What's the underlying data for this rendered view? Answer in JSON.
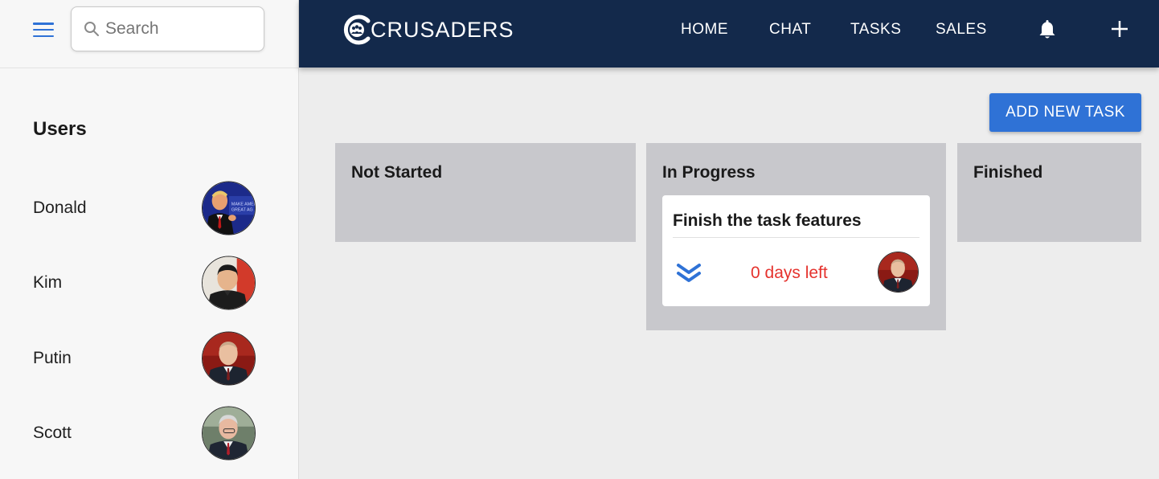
{
  "sidebar": {
    "search": {
      "placeholder": "Search",
      "value": ""
    },
    "users_heading": "Users",
    "users": [
      {
        "name": "Donald",
        "avatar": "donald-photo"
      },
      {
        "name": "Kim",
        "avatar": "kim-photo"
      },
      {
        "name": "Putin",
        "avatar": "putin-photo"
      },
      {
        "name": "Scott",
        "avatar": "scott-photo"
      }
    ]
  },
  "header": {
    "brand": "CRUSADERS",
    "nav": [
      "HOME",
      "CHAT",
      "TASKS",
      "SALES"
    ],
    "icons": [
      "bell-icon",
      "plus-icon"
    ]
  },
  "board": {
    "add_button_label": "ADD NEW TASK",
    "columns": [
      {
        "title": "Not Started",
        "tasks": []
      },
      {
        "title": "In Progress",
        "tasks": [
          {
            "title": "Finish the task features",
            "priority_icon": "double-chevron-down-icon",
            "due": "0 days left",
            "assignee_avatar": "putin-photo"
          }
        ]
      },
      {
        "title": "Finished",
        "tasks": []
      }
    ]
  },
  "colors": {
    "header_bg": "#13294b",
    "accent_blue": "#2f72d6",
    "due_red": "#e5322d",
    "column_bg": "#c8c8cc",
    "page_bg": "#ededed",
    "sidebar_bg": "#f7f7f7"
  }
}
